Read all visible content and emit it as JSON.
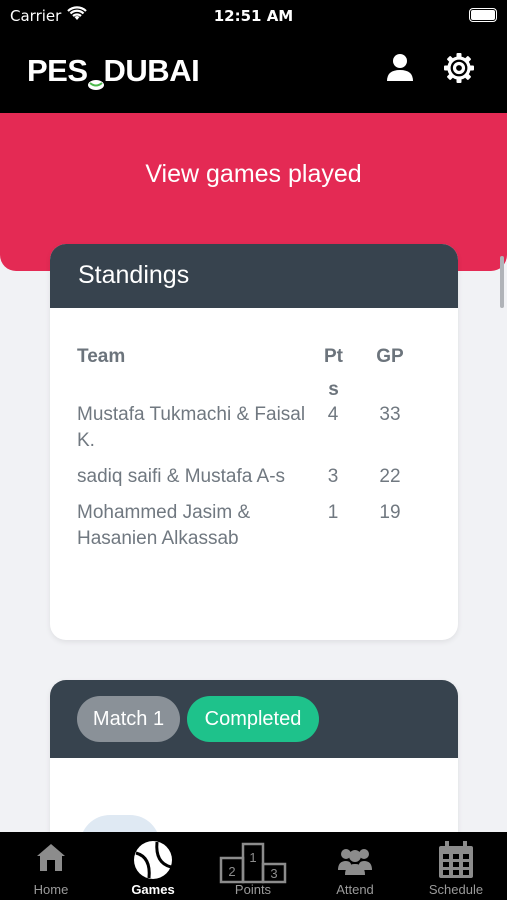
{
  "status_bar": {
    "carrier": "Carrier",
    "time": "12:51 AM"
  },
  "header": {
    "logo_left": "PES",
    "logo_right": "DUBAI"
  },
  "banner": {
    "label": "View games played"
  },
  "standings": {
    "title": "Standings",
    "columns": {
      "team": "Team",
      "pts": "Pts",
      "gp": "GP"
    },
    "rows": [
      {
        "team": "Mustafa Tukmachi & Faisal K.",
        "pts": "4",
        "gp": "33"
      },
      {
        "team": "sadiq saifi & Mustafa A-s",
        "pts": "3",
        "gp": "22"
      },
      {
        "team": "Mohammed Jasim & Hasanien Alkassab",
        "pts": "1",
        "gp": "19"
      }
    ]
  },
  "match": {
    "label": "Match 1",
    "status": "Completed"
  },
  "tabs": [
    {
      "label": "Home",
      "icon": "home-icon",
      "active": false
    },
    {
      "label": "Games",
      "icon": "tennis-ball-icon",
      "active": true
    },
    {
      "label": "Points",
      "icon": "podium-icon",
      "active": false
    },
    {
      "label": "Attend",
      "icon": "group-icon",
      "active": false
    },
    {
      "label": "Schedule",
      "icon": "calendar-icon",
      "active": false
    }
  ],
  "colors": {
    "banner": "#e42a54",
    "card_header": "#37434e",
    "completed": "#1ec28b",
    "match_pill": "#8a9198"
  }
}
